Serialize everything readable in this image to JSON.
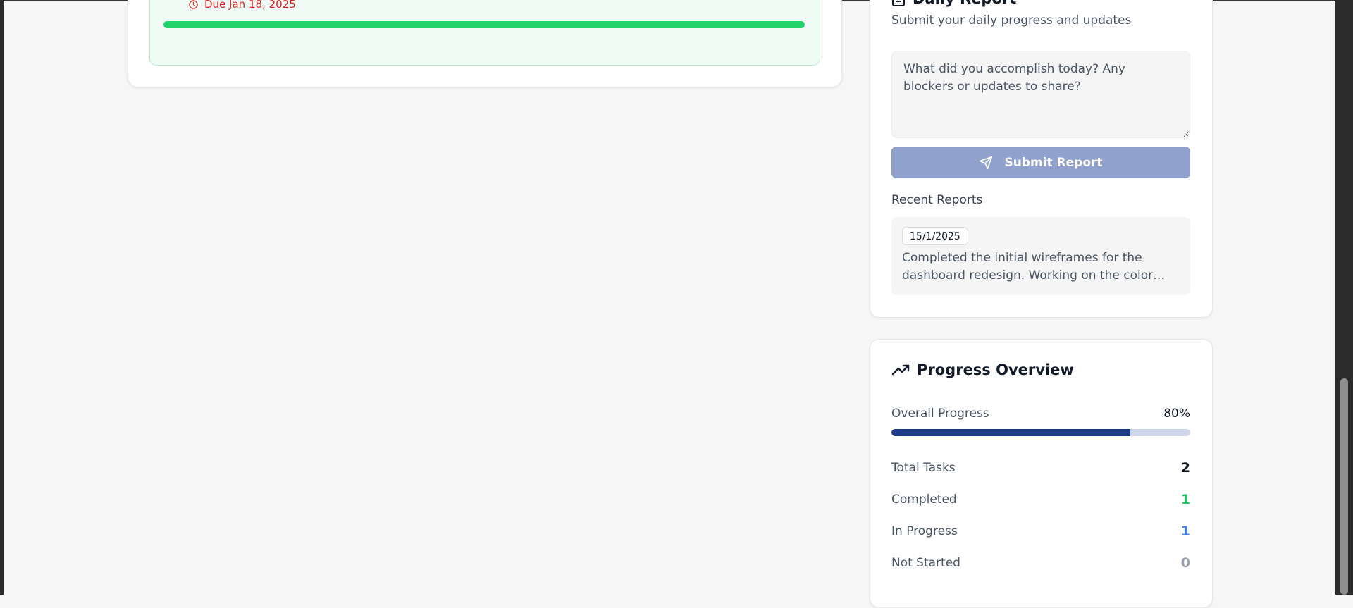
{
  "task": {
    "due_text": "Due Jan 18, 2025",
    "progress_percent": 100,
    "colors": {
      "due": "#dc2626",
      "bar": "#21d36b"
    }
  },
  "daily_report": {
    "title": "Daily Report",
    "subtitle": "Submit your daily progress and updates",
    "textarea_placeholder": "What did you accomplish today? Any blockers or updates to share?",
    "submit_label": "Submit Report",
    "recent_label": "Recent Reports",
    "recent": [
      {
        "date": "15/1/2025",
        "text": "Completed the initial wireframes for the dashboard redesign. Working on the color…"
      }
    ],
    "icons": {
      "title": "file-text-icon",
      "submit": "send-icon"
    }
  },
  "progress": {
    "title": "Progress Overview",
    "icon": "trending-up-icon",
    "overall_label": "Overall Progress",
    "overall_value": "80%",
    "overall_fraction": 0.8,
    "stats": [
      {
        "label": "Total Tasks",
        "value": "2",
        "color": "#111827"
      },
      {
        "label": "Completed",
        "value": "1",
        "color": "#22c55e"
      },
      {
        "label": "In Progress",
        "value": "1",
        "color": "#3b82f6"
      },
      {
        "label": "Not Started",
        "value": "0",
        "color": "#9ca3af"
      }
    ],
    "colors": {
      "bar_fill": "#1e3a8a",
      "bar_track": "#cfd6ea"
    }
  }
}
